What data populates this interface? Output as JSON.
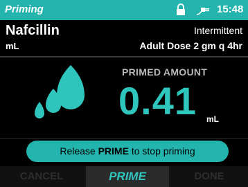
{
  "status": {
    "title": "Priming",
    "time": "15:48",
    "icons": [
      "lock-icon",
      "plug-icon"
    ]
  },
  "drug": {
    "name": "Nafcillin",
    "unit": "mL",
    "mode": "Intermittent",
    "dose": "Adult Dose 2 gm q 4hr"
  },
  "primed": {
    "label": "PRIMED AMOUNT",
    "value": "0.41",
    "unit": "mL"
  },
  "message": {
    "prefix": "Release ",
    "key": "PRIME",
    "suffix": " to stop priming"
  },
  "softkeys": {
    "cancel": "CANCEL",
    "prime": "PRIME",
    "done": "DONE"
  },
  "colors": {
    "accent": "#22b4ad",
    "value": "#2ec5bd",
    "background": "#000000"
  }
}
